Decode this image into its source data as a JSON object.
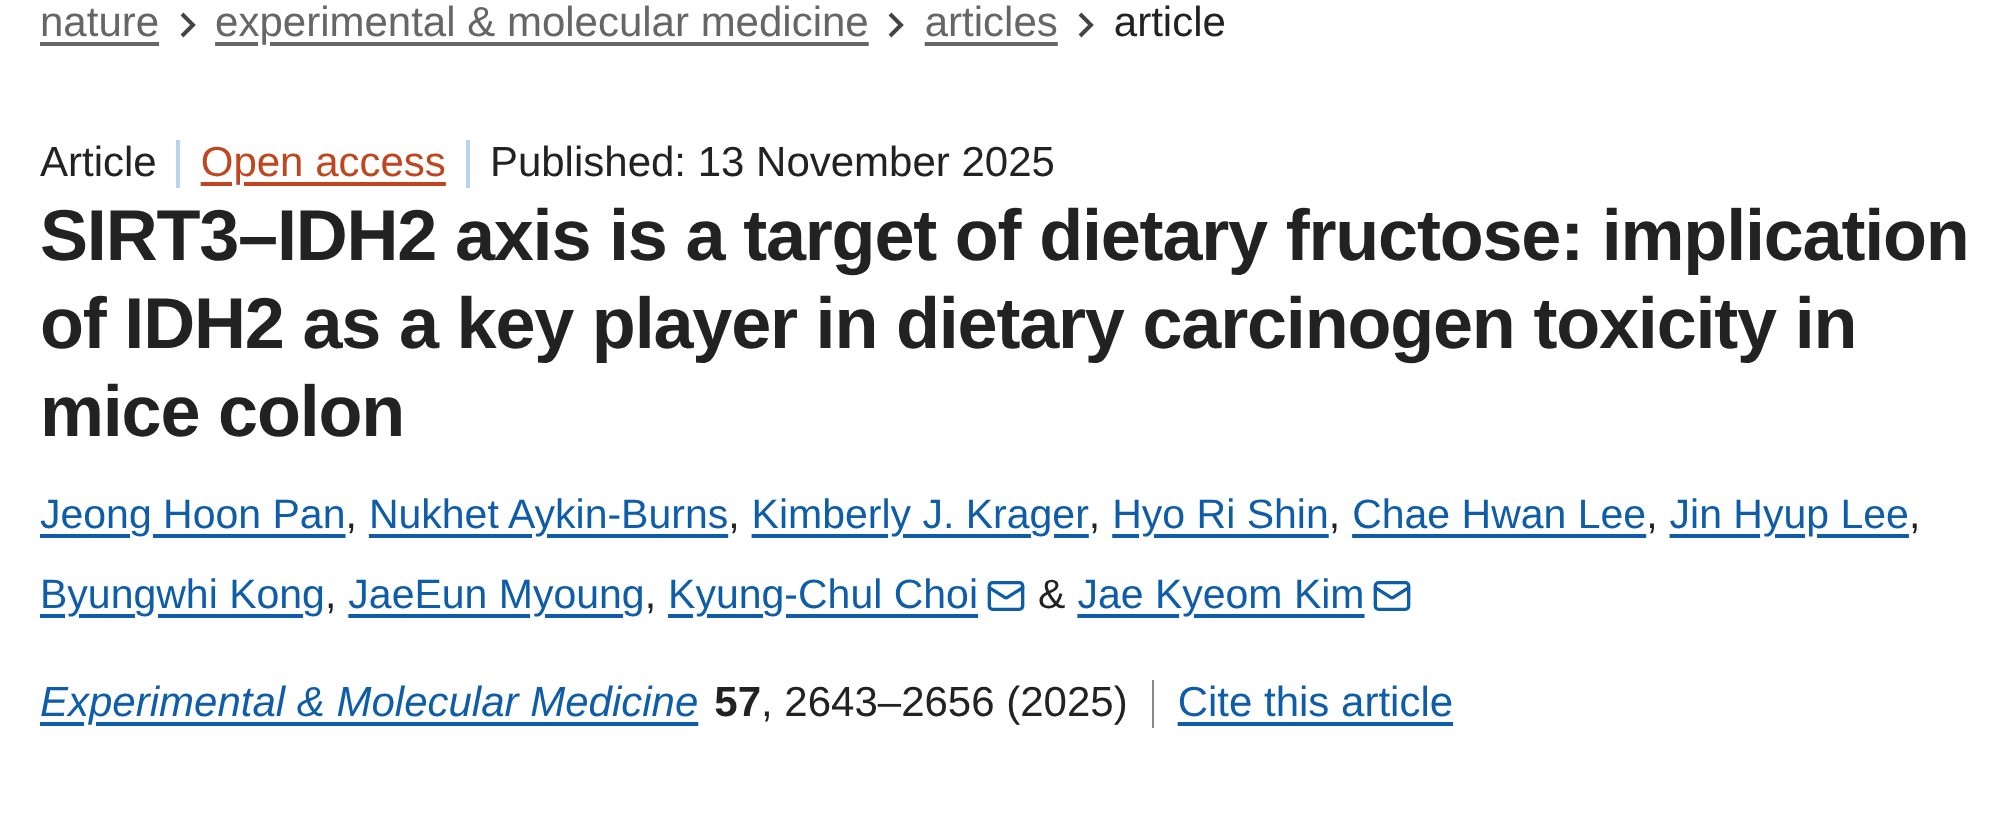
{
  "breadcrumbs": [
    {
      "label": "nature",
      "kind": "link"
    },
    {
      "label": "experimental & molecular medicine",
      "kind": "link"
    },
    {
      "label": "articles",
      "kind": "link"
    },
    {
      "label": "article",
      "kind": "current"
    }
  ],
  "meta": {
    "type": "Article",
    "access": "Open access",
    "published": "Published: 13 November 2025"
  },
  "title": "SIRT3–IDH2 axis is a target of dietary fructose: implication of IDH2 as a key player in dietary carcinogen toxicity in mice colon",
  "authors": [
    {
      "name": "Jeong Hoon Pan",
      "email": false,
      "separator": ","
    },
    {
      "name": "Nukhet Aykin-Burns",
      "email": false,
      "separator": ","
    },
    {
      "name": "Kimberly J. Krager",
      "email": false,
      "separator": ","
    },
    {
      "name": "Hyo Ri Shin",
      "email": false,
      "separator": ","
    },
    {
      "name": "Chae Hwan Lee",
      "email": false,
      "separator": ","
    },
    {
      "name": "Jin Hyup Lee",
      "email": false,
      "separator": ","
    },
    {
      "name": "Byungwhi Kong",
      "email": false,
      "separator": ","
    },
    {
      "name": "JaeEun Myoung",
      "email": false,
      "separator": ","
    },
    {
      "name": "Kyung-Chul Choi",
      "email": true,
      "separator": "&"
    },
    {
      "name": "Jae Kyeom Kim",
      "email": true
    }
  ],
  "citation": {
    "journal": "Experimental & Molecular Medicine",
    "volume": "57",
    "pages": ", 2643–2656 (2025)",
    "cite": "Cite this article"
  }
}
